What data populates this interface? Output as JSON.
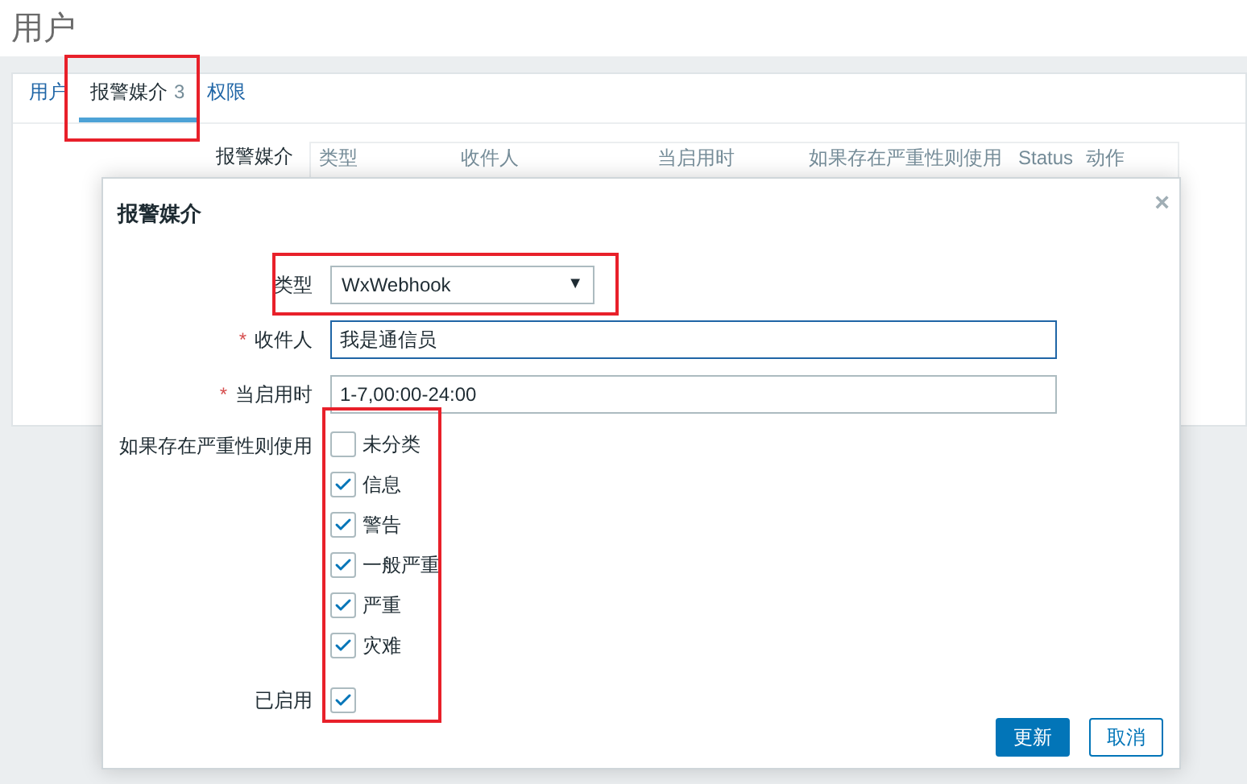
{
  "page_title": "用户",
  "tabs": [
    {
      "label": "用户",
      "selected": false,
      "highlighted": false
    },
    {
      "label": "报警媒介",
      "count": "3",
      "selected": true,
      "highlighted": true
    },
    {
      "label": "权限",
      "selected": false,
      "highlighted": false
    }
  ],
  "media_table": {
    "label": "报警媒介",
    "columns": [
      "类型",
      "收件人",
      "当启用时",
      "如果存在严重性则使用",
      "Status",
      "动作"
    ]
  },
  "dialog": {
    "title": "报警媒介",
    "close": "×",
    "type": {
      "label": "类型",
      "value": "WxWebhook",
      "arrow": "▼",
      "highlighted": true
    },
    "fields": [
      {
        "label": "收件人",
        "required_mark": "*",
        "value": "我是通信员",
        "focused": true
      },
      {
        "label": "当启用时",
        "required_mark": "*",
        "value": "1-7,00:00-24:00",
        "focused": false
      }
    ],
    "severity": {
      "label": "如果存在严重性则使用",
      "highlighted": true,
      "options": [
        {
          "label": "未分类",
          "checked": false
        },
        {
          "label": "信息",
          "checked": true
        },
        {
          "label": "警告",
          "checked": true
        },
        {
          "label": "一般严重",
          "checked": true
        },
        {
          "label": "严重",
          "checked": true
        },
        {
          "label": "灾难",
          "checked": true
        }
      ]
    },
    "enabled": {
      "label": "已启用",
      "checked": true
    },
    "buttons": [
      {
        "label": "更新",
        "kind": "primary"
      },
      {
        "label": "取消",
        "kind": "secondary"
      }
    ]
  }
}
